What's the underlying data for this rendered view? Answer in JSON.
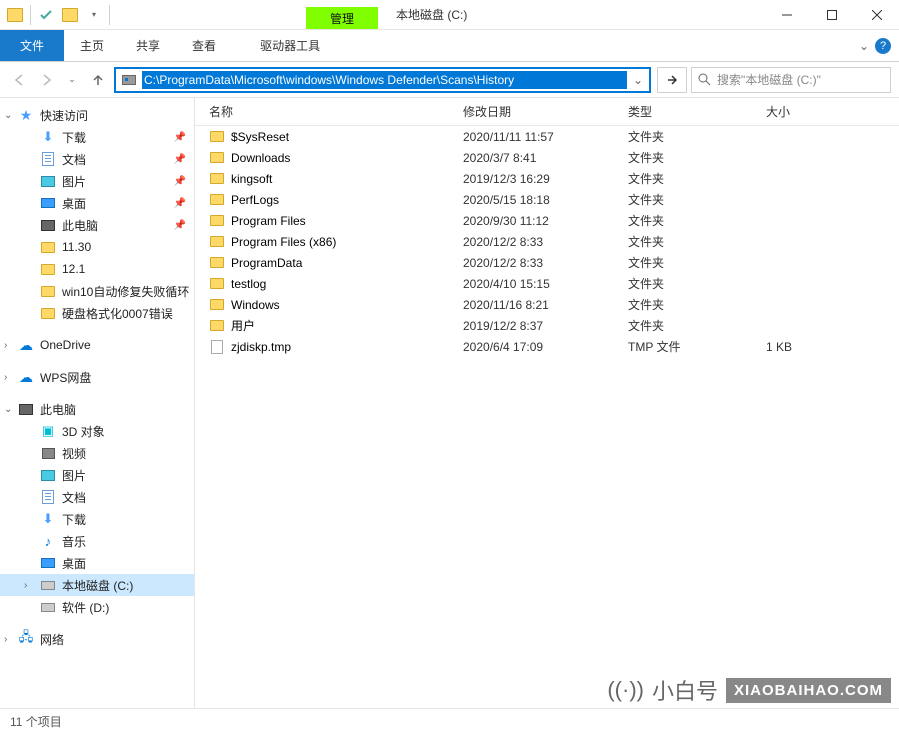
{
  "window": {
    "title": "本地磁盘 (C:)",
    "context_tab": "管理"
  },
  "ribbon": {
    "file": "文件",
    "home": "主页",
    "share": "共享",
    "view": "查看",
    "drive_tools": "驱动器工具"
  },
  "nav": {
    "address": "C:\\ProgramData\\Microsoft\\windows\\Windows Defender\\Scans\\History",
    "search_placeholder": "搜索\"本地磁盘 (C:)\""
  },
  "sidebar": {
    "quick_access": "快速访问",
    "quick_items": [
      {
        "label": "下载",
        "icon": "download",
        "pinned": true
      },
      {
        "label": "文档",
        "icon": "doc",
        "pinned": true
      },
      {
        "label": "图片",
        "icon": "pic",
        "pinned": true
      },
      {
        "label": "桌面",
        "icon": "desktop",
        "pinned": true
      },
      {
        "label": "此电脑",
        "icon": "pc",
        "pinned": true
      },
      {
        "label": "11.30",
        "icon": "folder",
        "pinned": false
      },
      {
        "label": "12.1",
        "icon": "folder",
        "pinned": false
      },
      {
        "label": "win10自动修复失败循环",
        "icon": "folder",
        "pinned": false
      },
      {
        "label": "硬盘格式化0007错误",
        "icon": "folder",
        "pinned": false
      }
    ],
    "onedrive": "OneDrive",
    "wps": "WPS网盘",
    "this_pc": "此电脑",
    "pc_items": [
      {
        "label": "3D 对象",
        "icon": "3d"
      },
      {
        "label": "视频",
        "icon": "video"
      },
      {
        "label": "图片",
        "icon": "pic"
      },
      {
        "label": "文档",
        "icon": "doc"
      },
      {
        "label": "下载",
        "icon": "download"
      },
      {
        "label": "音乐",
        "icon": "music"
      },
      {
        "label": "桌面",
        "icon": "desktop"
      },
      {
        "label": "本地磁盘 (C:)",
        "icon": "drive",
        "selected": true
      },
      {
        "label": "软件 (D:)",
        "icon": "drive"
      }
    ],
    "network": "网络"
  },
  "columns": {
    "name": "名称",
    "date": "修改日期",
    "type": "类型",
    "size": "大小"
  },
  "files": [
    {
      "name": "$SysReset",
      "date": "2020/11/11 11:57",
      "type": "文件夹",
      "size": "",
      "icon": "folder"
    },
    {
      "name": "Downloads",
      "date": "2020/3/7 8:41",
      "type": "文件夹",
      "size": "",
      "icon": "folder"
    },
    {
      "name": "kingsoft",
      "date": "2019/12/3 16:29",
      "type": "文件夹",
      "size": "",
      "icon": "folder"
    },
    {
      "name": "PerfLogs",
      "date": "2020/5/15 18:18",
      "type": "文件夹",
      "size": "",
      "icon": "folder"
    },
    {
      "name": "Program Files",
      "date": "2020/9/30 11:12",
      "type": "文件夹",
      "size": "",
      "icon": "folder"
    },
    {
      "name": "Program Files (x86)",
      "date": "2020/12/2 8:33",
      "type": "文件夹",
      "size": "",
      "icon": "folder"
    },
    {
      "name": "ProgramData",
      "date": "2020/12/2 8:33",
      "type": "文件夹",
      "size": "",
      "icon": "folder"
    },
    {
      "name": "testlog",
      "date": "2020/4/10 15:15",
      "type": "文件夹",
      "size": "",
      "icon": "folder"
    },
    {
      "name": "Windows",
      "date": "2020/11/16 8:21",
      "type": "文件夹",
      "size": "",
      "icon": "folder"
    },
    {
      "name": "用户",
      "date": "2019/12/2 8:37",
      "type": "文件夹",
      "size": "",
      "icon": "folder"
    },
    {
      "name": "zjdiskp.tmp",
      "date": "2020/6/4 17:09",
      "type": "TMP 文件",
      "size": "1 KB",
      "icon": "tmp"
    }
  ],
  "status": {
    "item_count": "11 个项目"
  },
  "watermark": {
    "cn": "小白号",
    "en": "XIAOBAIHAO.COM"
  }
}
